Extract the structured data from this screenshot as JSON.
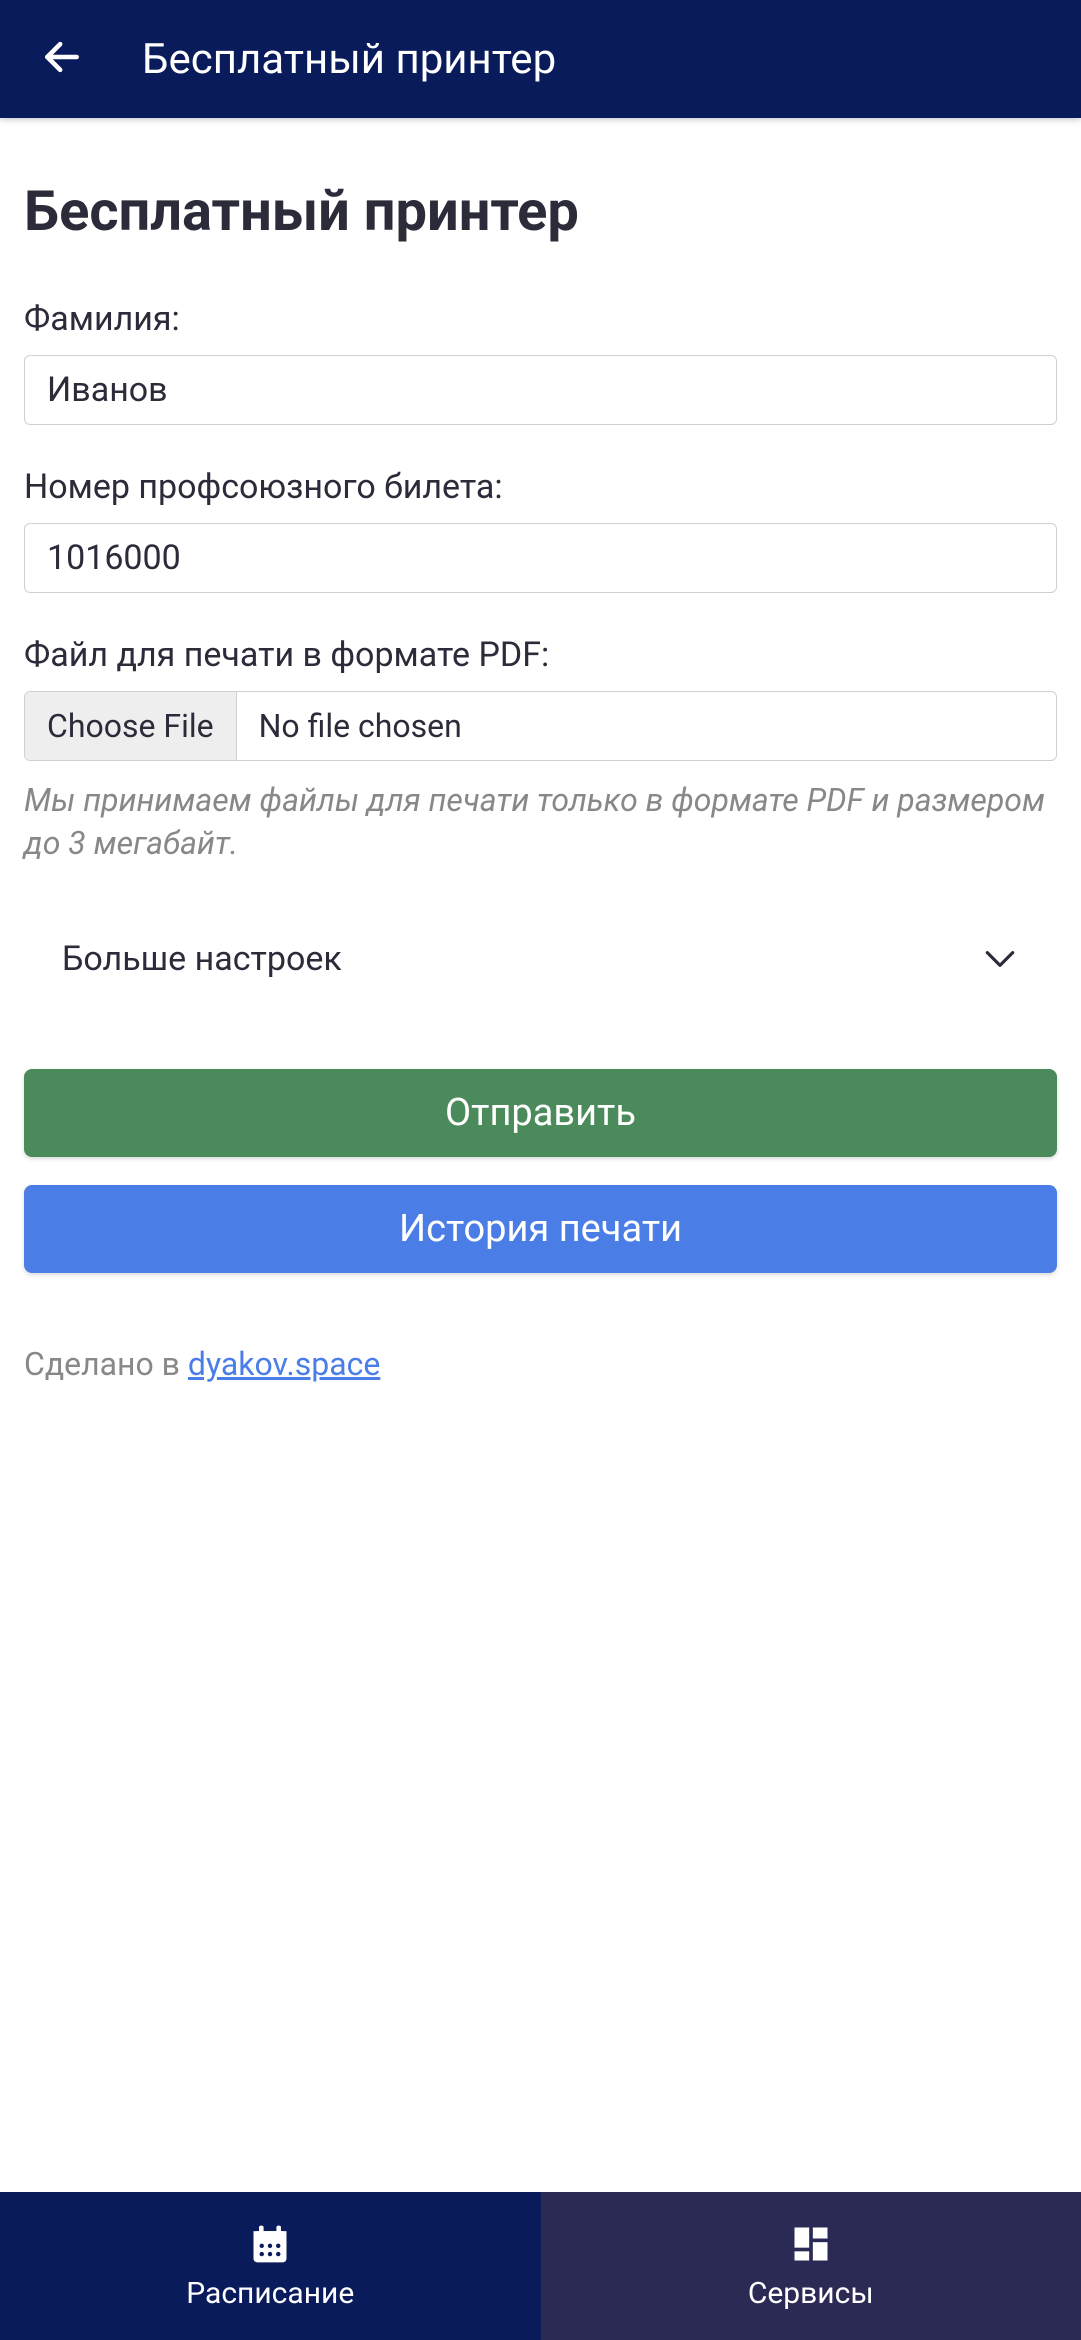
{
  "header": {
    "title": "Бесплатный принтер"
  },
  "page": {
    "title": "Бесплатный принтер"
  },
  "form": {
    "surname": {
      "label": "Фамилия:",
      "value": "Иванов"
    },
    "ticket": {
      "label": "Номер профсоюзного билета:",
      "value": "1016000"
    },
    "file": {
      "label": "Файл для печати в формате PDF:",
      "choose_label": "Choose File",
      "status": "No file chosen",
      "helper": "Мы принимаем файлы для печати только в формате PDF и размером до 3 мегабайт."
    },
    "expander": {
      "label": "Больше настроек"
    },
    "submit_label": "Отправить",
    "history_label": "История печати"
  },
  "footer": {
    "made_in": "Сделано в ",
    "link_text": "dyakov.space"
  },
  "nav": {
    "schedule_label": "Расписание",
    "services_label": "Сервисы"
  }
}
